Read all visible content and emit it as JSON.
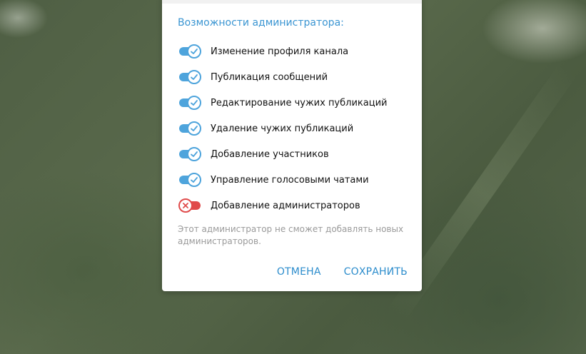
{
  "dialog": {
    "section_title": "Возможности администратора:",
    "permissions": [
      {
        "label": "Изменение профиля канала",
        "enabled": true
      },
      {
        "label": "Публикация сообщений",
        "enabled": true
      },
      {
        "label": "Редактирование чужих публикаций",
        "enabled": true
      },
      {
        "label": "Удаление чужих публикаций",
        "enabled": true
      },
      {
        "label": "Добавление участников",
        "enabled": true
      },
      {
        "label": "Управление голосовыми чатами",
        "enabled": true
      },
      {
        "label": "Добавление администраторов",
        "enabled": false
      }
    ],
    "note": "Этот администратор не сможет добавлять новых администраторов.",
    "cancel_label": "ОТМЕНА",
    "save_label": "СОХРАНИТЬ"
  },
  "colors": {
    "accent": "#3a95d2",
    "toggle_on": "#4ea4dc",
    "toggle_off": "#e04b4b",
    "note_text": "#9a9a9a"
  },
  "icons": {
    "on": "check-icon",
    "off": "cross-icon"
  }
}
